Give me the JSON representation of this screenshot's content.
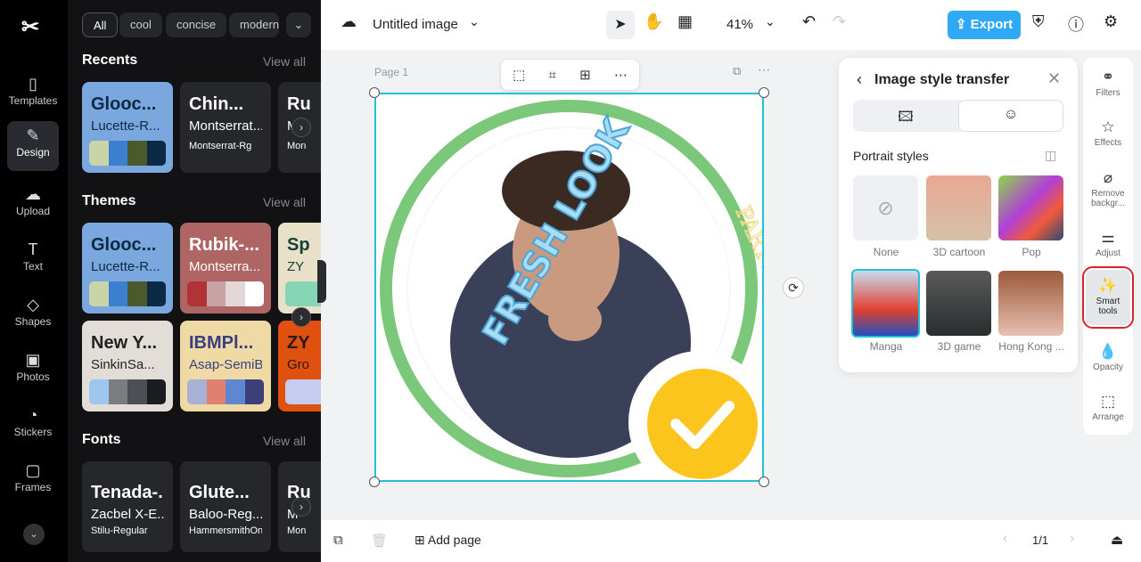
{
  "nav": {
    "items": [
      {
        "label": "Templates",
        "icon": "templates-icon"
      },
      {
        "label": "Design",
        "icon": "design-icon",
        "active": true
      },
      {
        "label": "Upload",
        "icon": "upload-icon"
      },
      {
        "label": "Text",
        "icon": "text-icon"
      },
      {
        "label": "Shapes",
        "icon": "shapes-icon"
      },
      {
        "label": "Photos",
        "icon": "photos-icon"
      },
      {
        "label": "Stickers",
        "icon": "stickers-icon"
      },
      {
        "label": "Frames",
        "icon": "frames-icon"
      }
    ]
  },
  "panel": {
    "chips": [
      "All",
      "cool",
      "concise",
      "modern"
    ],
    "recents": {
      "title": "Recents",
      "view_all": "View all",
      "cards": [
        {
          "t1": "Glooc...",
          "t2": "Lucette-R...",
          "bg": "#7ba7df",
          "fg": "#0d2a45",
          "palette": [
            "#c9d4a8",
            "#3a7fd0",
            "#4a5a2c",
            "#0c2a45"
          ]
        },
        {
          "t1": "Chin...",
          "t2": "Montserrat...",
          "t3": "Montserrat-Rg",
          "bg": "#26272b",
          "fg": "#fff"
        },
        {
          "t1": "Ru",
          "t2": "M",
          "t3": "Mon",
          "bg": "#26272b",
          "fg": "#fff"
        }
      ]
    },
    "themes": {
      "title": "Themes",
      "view_all": "View all",
      "cards": [
        {
          "t1": "Glooc...",
          "t2": "Lucette-R...",
          "bg": "#7ba7df",
          "fg": "#0d2a45",
          "palette": [
            "#c9d4a8",
            "#3a7fd0",
            "#4a5a2c",
            "#0c2a45"
          ]
        },
        {
          "t1": "Rubik-...",
          "t2": "Montserra...",
          "bg": "#b06565",
          "fg": "#fff",
          "palette": [
            "#b03338",
            "#c9a2a3",
            "#e2d6d6",
            "#ffffff"
          ]
        },
        {
          "t1": "Sp",
          "t2": "ZY",
          "bg": "#e8e0c8",
          "fg": "#16403a",
          "palette": [
            "#86d5b6"
          ]
        },
        {
          "t1": "New Y...",
          "t2": "SinkinSa...",
          "bg": "#e2ddd6",
          "fg": "#222",
          "palette": [
            "#9fc6ee",
            "#7a7d80",
            "#4c4f55",
            "#1a1c20"
          ]
        },
        {
          "t1": "IBMPl...",
          "t2": "Asap-SemiB...",
          "bg": "#efd9a5",
          "fg": "#3a3f80",
          "palette": [
            "#a9b0d6",
            "#e0806e",
            "#5f86d0",
            "#3c3f78"
          ]
        },
        {
          "t1": "ZY",
          "t2": "Gro",
          "bg": "#e0500f",
          "fg": "#2a1a10",
          "palette": [
            "#c5ccf0"
          ]
        }
      ]
    },
    "fonts": {
      "title": "Fonts",
      "view_all": "View all",
      "cards": [
        {
          "t1": "Tenada-...",
          "t2": "Zacbel X-E...",
          "t3": "Stilu-Regular"
        },
        {
          "t1": "Glute...",
          "t2": "Baloo-Reg...",
          "t3": "HammersmithOn..."
        },
        {
          "t1": "Ru",
          "t2": "M",
          "t3": "Mon"
        }
      ]
    }
  },
  "topbar": {
    "title": "Untitled image",
    "zoom": "41%",
    "export": "Export"
  },
  "canvas": {
    "page_label": "Page 1",
    "text_left": "FRESH LOOK",
    "text_right": "PARTY TODAY"
  },
  "style_panel": {
    "title": "Image style transfer",
    "section": "Portrait styles",
    "styles": [
      {
        "label": "None"
      },
      {
        "label": "3D cartoon"
      },
      {
        "label": "Pop"
      },
      {
        "label": "Manga",
        "selected": true
      },
      {
        "label": "3D game"
      },
      {
        "label": "Hong Kong ..."
      }
    ]
  },
  "right_tools": [
    {
      "label": "Filters",
      "icon": "filters-icon"
    },
    {
      "label": "Effects",
      "icon": "effects-icon"
    },
    {
      "label": "Remove backgr...",
      "icon": "remove-background-icon"
    },
    {
      "label": "Adjust",
      "icon": "adjust-icon"
    },
    {
      "label": "Smart tools",
      "icon": "smart-tools-icon",
      "active": true
    },
    {
      "label": "Opacity",
      "icon": "opacity-icon"
    },
    {
      "label": "Arrange",
      "icon": "arrange-icon"
    }
  ],
  "bottombar": {
    "add_page": "Add page",
    "page_counter": "1/1"
  },
  "colors": {
    "accent": "#2fa8f5",
    "selection": "#22c1d9",
    "highlight": "#e0202a"
  }
}
